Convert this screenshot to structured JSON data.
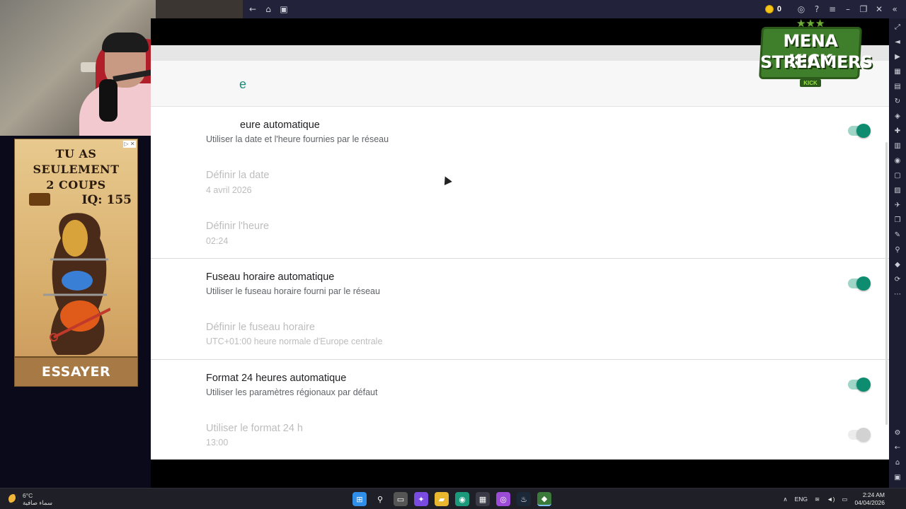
{
  "titlebar": {
    "coin_count": "0",
    "left_icons": [
      "back-arrow-icon",
      "home-icon",
      "recent-apps-icon"
    ],
    "right_icons": [
      "account-icon",
      "help-icon",
      "menu-icon",
      "minimize-icon",
      "restore-icon",
      "close-icon",
      "collapse-icon"
    ]
  },
  "settings": {
    "header_title_fragment": "e",
    "rows": [
      {
        "title": "eure automatique",
        "subtitle": "Utiliser la date et l'heure fournies par le réseau",
        "toggle": "on",
        "enabled": true
      },
      {
        "title": "Définir la date",
        "subtitle": "4 avril 2026",
        "enabled": false
      },
      {
        "title": "Définir l'heure",
        "subtitle": "02:24",
        "enabled": false
      },
      {
        "title": "Fuseau horaire automatique",
        "subtitle": "Utiliser le fuseau horaire fourni par le réseau",
        "toggle": "on",
        "enabled": true
      },
      {
        "title": "Définir le fuseau horaire",
        "subtitle": "UTC+01:00 heure normale d'Europe centrale",
        "enabled": false
      },
      {
        "title": "Format 24 heures automatique",
        "subtitle": "Utiliser les paramètres régionaux par défaut",
        "toggle": "on",
        "enabled": true
      },
      {
        "title": "Utiliser le format 24 h",
        "subtitle": "13:00",
        "toggle": "off",
        "enabled": false
      }
    ]
  },
  "ad": {
    "headline_line1": "TU AS SEULEMENT",
    "headline_line2": "2 COUPS",
    "iq": "IQ: 155",
    "cta": "ESSAYER"
  },
  "logo": {
    "stars": "★★★",
    "line1": "MENA KICK",
    "line2": "STREAMERS",
    "tag": "KICK"
  },
  "taskbar": {
    "weather_temp": "6°C",
    "weather_desc": "سماء صافية",
    "language": "ENG",
    "time": "2:24 AM",
    "date": "04/04/2026"
  },
  "colors": {
    "accent": "#0e8c6f",
    "accent_track": "#9fd6c7",
    "emulator_chrome": "#22233a"
  }
}
